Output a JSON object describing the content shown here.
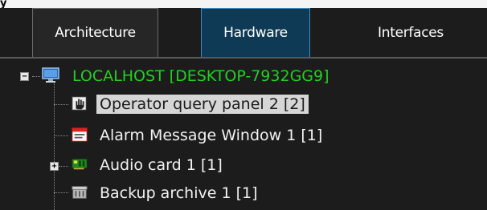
{
  "tabs": [
    {
      "label": "Architecture",
      "state": "normal"
    },
    {
      "label": "Hardware",
      "state": "active"
    },
    {
      "label": "Interfaces",
      "state": "normal"
    }
  ],
  "tree": {
    "root": {
      "label": "LOCALHOST [DESKTOP-7932GG9]",
      "icon": "computer-monitor-icon",
      "expanded": true
    },
    "children": [
      {
        "label": "Operator query panel 2 [2]",
        "icon": "hand-pointer-icon",
        "selected": true
      },
      {
        "label": "Alarm Message Window 1 [1]",
        "icon": "message-window-icon",
        "selected": false
      },
      {
        "label": "Audio card 1 [1]",
        "icon": "audio-card-icon",
        "selected": false,
        "expandable": true
      },
      {
        "label": "Backup archive 1 [1]",
        "icon": "archive-icon",
        "selected": false
      }
    ]
  },
  "colors": {
    "root_text": "#22d022",
    "active_tab_bg": "#0f3a55",
    "active_tab_border": "#3b8cc4",
    "selected_bg": "#d6d6d6"
  }
}
